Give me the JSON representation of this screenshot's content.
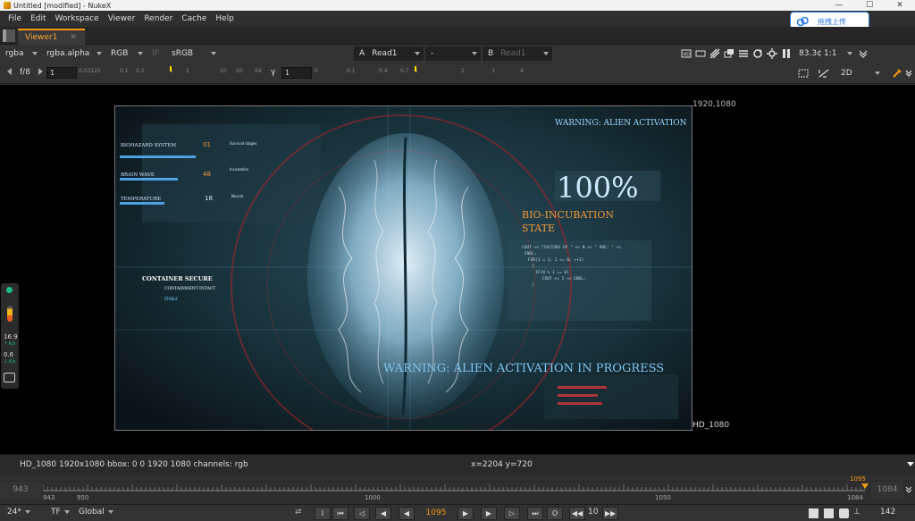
{
  "window": {
    "title": "Untitled [modified] - NukeX",
    "controls": [
      "—",
      "☐",
      "✕"
    ]
  },
  "menu": [
    "File",
    "Edit",
    "Workspace",
    "Viewer",
    "Render",
    "Cache",
    "Help"
  ],
  "upload_widget": {
    "label": "拖拽上传"
  },
  "tab": {
    "label": "Viewer1",
    "close": "✕"
  },
  "viewer_toolbar": {
    "channels": "rgba",
    "alpha": "rgba.alpha",
    "display": "RGB",
    "ip": "IP",
    "colorspace": "sRGB",
    "input_a_label": "A",
    "input_a": "Read1",
    "merge_mode": "-",
    "input_b_label": "B",
    "input_b": "Read1",
    "zoom": "83.3¢",
    "ratio": "1:1"
  },
  "viewer_toolbar2": {
    "fstop_label": "f/8",
    "gain": "1",
    "gamma_label": "γ",
    "gamma": "1",
    "gain_scale": [
      "0.03125",
      "0.1",
      "0.2",
      "1",
      "2",
      "10",
      "20",
      "64"
    ],
    "gamma_scale": [
      "0",
      "0.1",
      "0.4",
      "0.7",
      "1",
      "2",
      "3",
      "4"
    ],
    "view_mode": "2D"
  },
  "viewer": {
    "format_top_right": "1920,1080",
    "format_bottom_right": "HD_1080"
  },
  "image_overlay": {
    "warning_top": "WARNING: ALIEN ACTIVATION",
    "percent": "100%",
    "bio_line1": "BIO-INCUBATION",
    "bio_line2": "STATE",
    "code": [
      "COUT << \"FACTORS OF \" << N << \" ARE: \" <<",
      "ENDL;",
      "FOR(I = 1; I <= N; ++I)",
      "{",
      "IF(N % I == 0)",
      "COUT << I << ENDL;",
      "}"
    ],
    "bottom_warning": "WARNING: ALIEN ACTIVATION IN PROGRESS",
    "container_secure": "CONTAINER SECURE",
    "containment_intact": "CONTAINMENT INTACT",
    "stable": "STABLE",
    "left_labels": [
      "BIOHAZARD SYSTEM",
      "BRAIN WAVE",
      "TEMPERATURE"
    ],
    "left_values": [
      "01",
      "48",
      "18"
    ],
    "mid_labels": [
      "Survival stages",
      "Incubation",
      "Neural"
    ]
  },
  "side_widget": {
    "rate1": "16.9",
    "unit1": "↑ K/s",
    "rate2": "0.6",
    "unit2": "↓ K/s"
  },
  "infobar": {
    "info": "HD_1080 1920x1080  bbox: 0 0 1920 1080 channels: rgb",
    "coords": "x=2204 y=720"
  },
  "timeline": {
    "first_frame": "943",
    "last_frame": "1084",
    "tick_start": "943",
    "tick_950": "950",
    "tick_1000": "1000",
    "tick_1050": "1050",
    "tick_end": "1084",
    "playhead": "1095"
  },
  "playback": {
    "fps": "24*",
    "tf": "TF",
    "scope": "Global",
    "current_frame": "1095",
    "increment": "10",
    "frame_count": "142",
    "btn_in": "I",
    "btn_out": "O"
  },
  "colors": {
    "accent": "#f79a12",
    "upload_blue": "#2a7be4",
    "hud_cyan": "#7fd6ff"
  }
}
